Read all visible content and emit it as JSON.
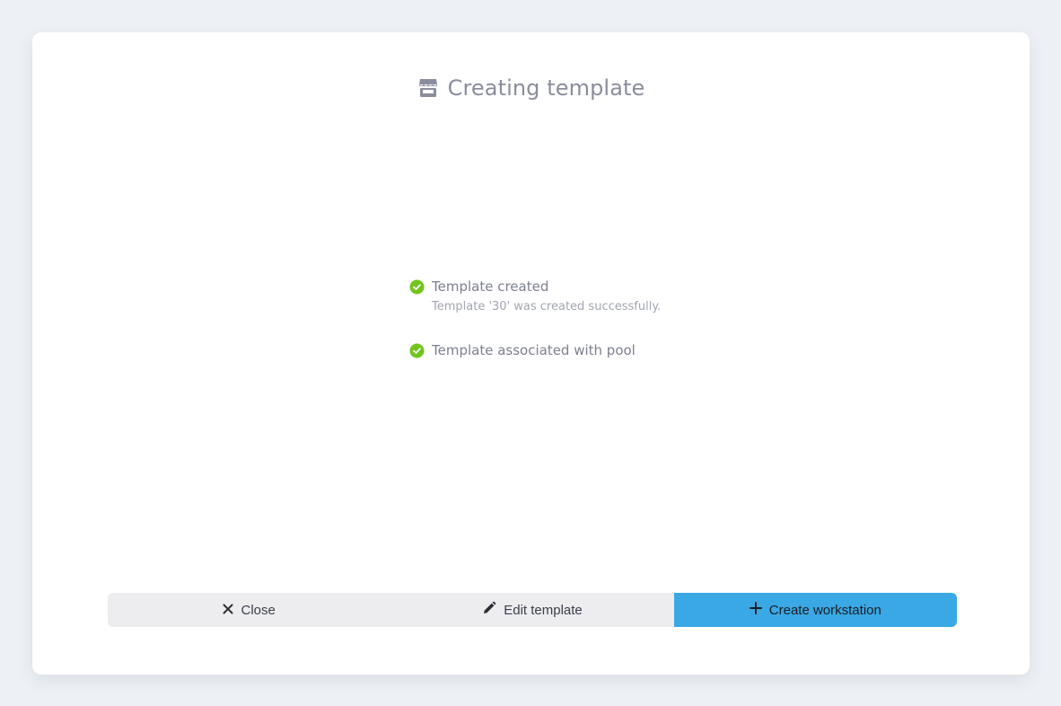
{
  "modal": {
    "title": "Creating template",
    "title_icon": "store-icon"
  },
  "steps": [
    {
      "label": "Template created",
      "detail": "Template '30' was created successfully.",
      "status": "success",
      "icon": "check-circle-icon"
    },
    {
      "label": "Template associated with pool",
      "status": "success",
      "icon": "check-circle-icon"
    }
  ],
  "footer": {
    "close_label": "Close",
    "close_icon": "close-icon",
    "edit_label": "Edit template",
    "edit_icon": "pencil-icon",
    "create_label": "Create workstation",
    "create_icon": "plus-icon"
  },
  "colors": {
    "success": "#73c41d",
    "primary": "#3aa8e4",
    "secondary_button": "#ededef",
    "title": "#8a8d9c",
    "background": "#edf1f5"
  }
}
